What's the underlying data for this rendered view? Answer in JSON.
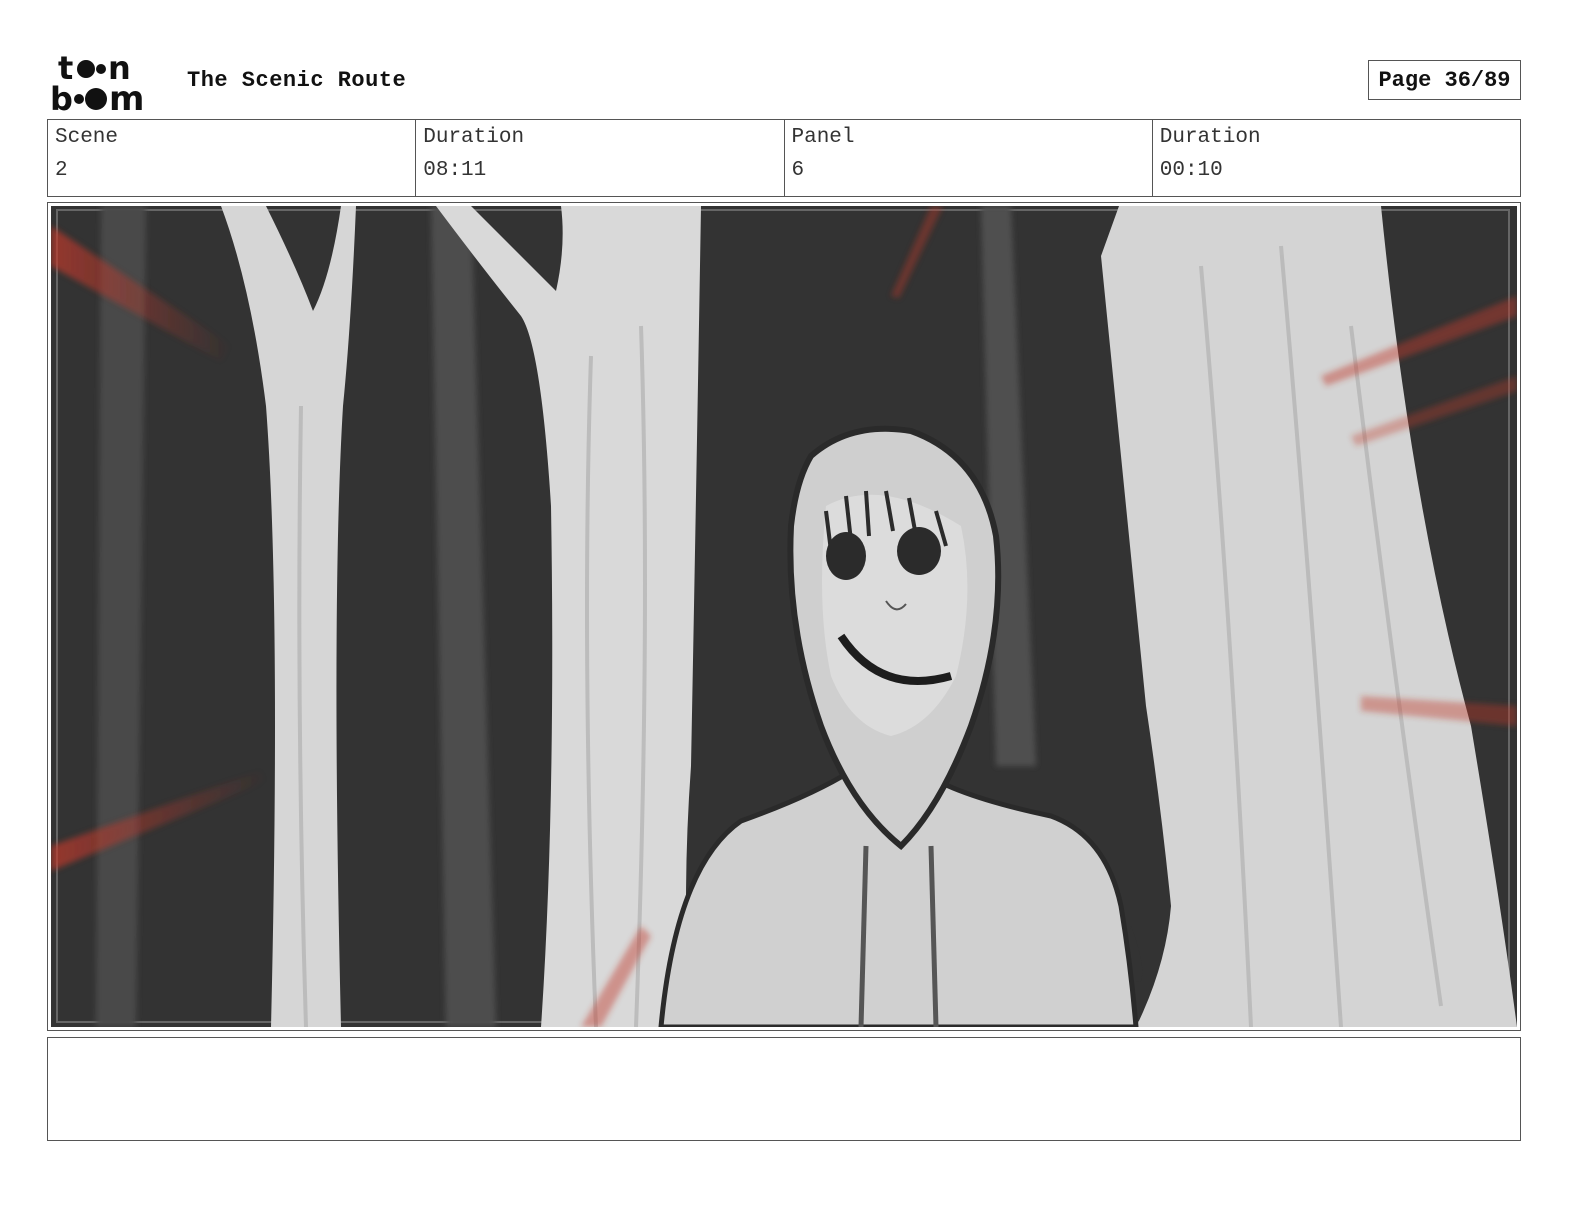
{
  "header": {
    "logo_alt": "toonboom",
    "title": "The Scenic Route",
    "page_label": "Page 36/89"
  },
  "info": {
    "scene_label": "Scene",
    "scene_value": "2",
    "scene_duration_label": "Duration",
    "scene_duration_value": "08:11",
    "panel_label": "Panel",
    "panel_value": "6",
    "panel_duration_label": "Duration",
    "panel_duration_value": "00:10"
  },
  "panel": {
    "image_description_icon": "storyboard-sketch",
    "colors": {
      "background": "#333333",
      "tree": "#d6d6d6",
      "accent": "#c0392b"
    }
  },
  "notes": {
    "text": ""
  }
}
